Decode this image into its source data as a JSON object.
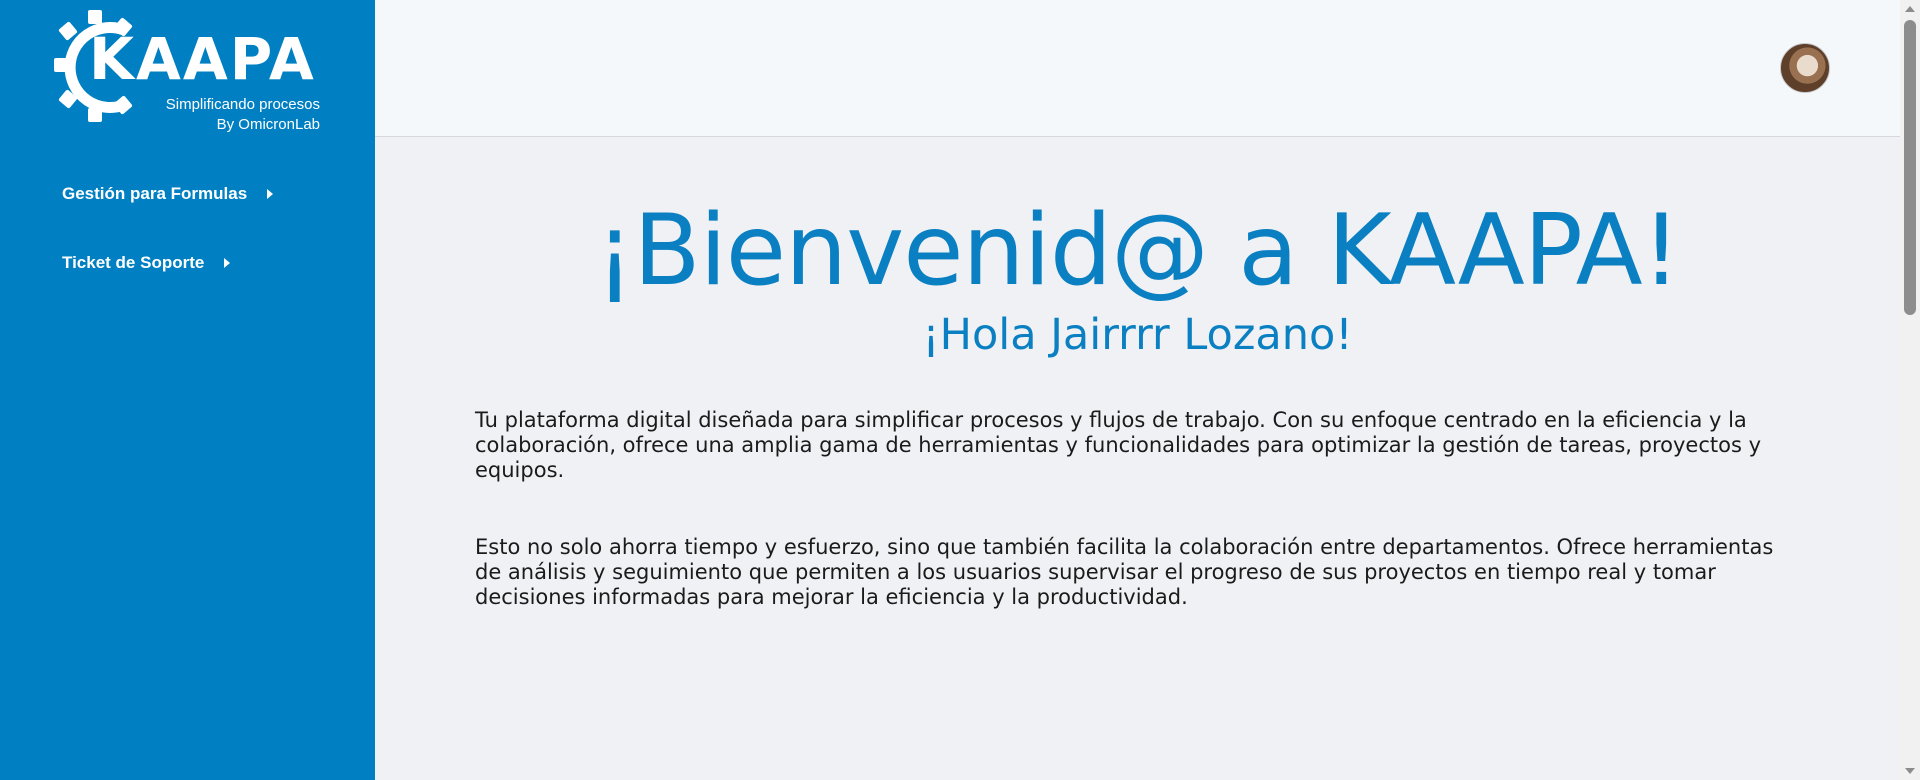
{
  "brand": {
    "title": "KAAPA",
    "tagline": "Simplificando procesos",
    "byline": "By OmicronLab",
    "color": "#0080c3"
  },
  "sidebar": {
    "items": [
      {
        "label": "Gestión para Formulas",
        "icon": "caret-right-icon"
      },
      {
        "label": "Ticket de Soporte",
        "icon": "caret-right-icon"
      }
    ]
  },
  "header": {
    "avatar": "user-avatar"
  },
  "main": {
    "title": "¡Bienvenid@ a KAAPA!",
    "greeting": "¡Hola Jairrrr Lozano!",
    "paragraphs": [
      "Tu plataforma digital diseñada para simplificar procesos y flujos de trabajo. Con su enfoque centrado en la eficiencia y la colaboración, ofrece una amplia gama de herramientas y funcionalidades para optimizar la gestión de tareas, proyectos y equipos.",
      "Esto no solo ahorra tiempo y esfuerzo, sino que también facilita la colaboración entre departamentos. Ofrece herramientas de análisis y seguimiento que permiten a los usuarios supervisar el progreso de sus proyectos en tiempo real y tomar decisiones informadas para mejorar la eficiencia y la productividad."
    ],
    "accent_color": "#0a7fc2"
  }
}
